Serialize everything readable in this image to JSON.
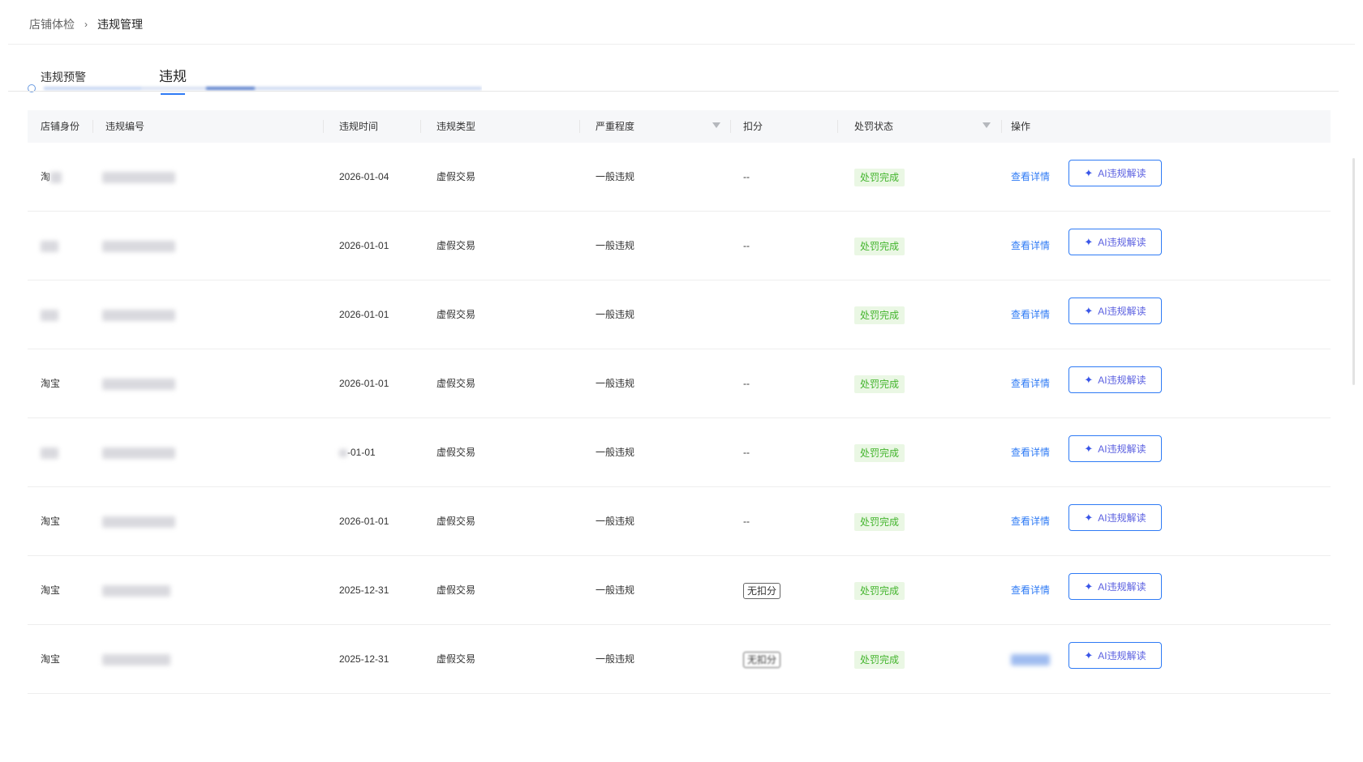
{
  "breadcrumb": {
    "parent": "店铺体检",
    "separator": "›",
    "current": "违规管理"
  },
  "tabs": [
    {
      "label": "违规预警",
      "active": false
    },
    {
      "label": "违规",
      "active": true
    }
  ],
  "table": {
    "columns": {
      "identity": "店铺身份",
      "code": "违规编号",
      "time": "违规时间",
      "type": "违规类型",
      "severity": "严重程度",
      "deduction": "扣分",
      "status": "处罚状态",
      "action": "操作"
    },
    "rows": [
      {
        "identity": "淘",
        "time": "2026-01-04",
        "type": "虚假交易",
        "severity": "一般违规",
        "deduction": "--",
        "deduction_tag": "",
        "status": "处罚完成",
        "detail": "查看详情",
        "ai": "AI违规解读"
      },
      {
        "identity": "",
        "time": "2026-01-01",
        "type": "虚假交易",
        "severity": "一般违规",
        "deduction": "--",
        "deduction_tag": "",
        "status": "处罚完成",
        "detail": "查看详情",
        "ai": "AI违规解读"
      },
      {
        "identity": "",
        "time": "2026-01-01",
        "type": "虚假交易",
        "severity": "一般违规",
        "deduction": "",
        "deduction_tag": "",
        "status": "处罚完成",
        "detail": "查看详情",
        "ai": "AI违规解读"
      },
      {
        "identity": "淘宝",
        "time": "2026-01-01",
        "type": "虚假交易",
        "severity": "一般违规",
        "deduction": "--",
        "deduction_tag": "",
        "status": "处罚完成",
        "detail": "查看详情",
        "ai": "AI违规解读"
      },
      {
        "identity": "",
        "time": "-01-01",
        "type": "虚假交易",
        "severity": "一般违规",
        "deduction": "--",
        "deduction_tag": "",
        "status": "处罚完成",
        "detail": "查看详情",
        "ai": "AI违规解读"
      },
      {
        "identity": "淘宝",
        "time": "2026-01-01",
        "type": "虚假交易",
        "severity": "一般违规",
        "deduction": "--",
        "deduction_tag": "",
        "status": "处罚完成",
        "detail": "查看详情",
        "ai": "AI违规解读"
      },
      {
        "identity": "淘宝",
        "time": "2025-12-31",
        "type": "虚假交易",
        "severity": "一般违规",
        "deduction": "",
        "deduction_tag": "无扣分",
        "status": "处罚完成",
        "detail": "查看详情",
        "ai": "AI违规解读"
      },
      {
        "identity": "淘宝",
        "time": "2025-12-31",
        "type": "虚假交易",
        "severity": "一般违规",
        "deduction": "",
        "deduction_tag": "无扣分",
        "status": "处罚完成",
        "detail": "",
        "ai": "AI违规解读"
      }
    ]
  },
  "icons": {
    "ai_star": "sparkle-icon",
    "filter": "filter-icon"
  },
  "colors": {
    "link": "#2f7bf5",
    "status_text": "#44b52e",
    "status_bg": "#eaf7e4"
  }
}
